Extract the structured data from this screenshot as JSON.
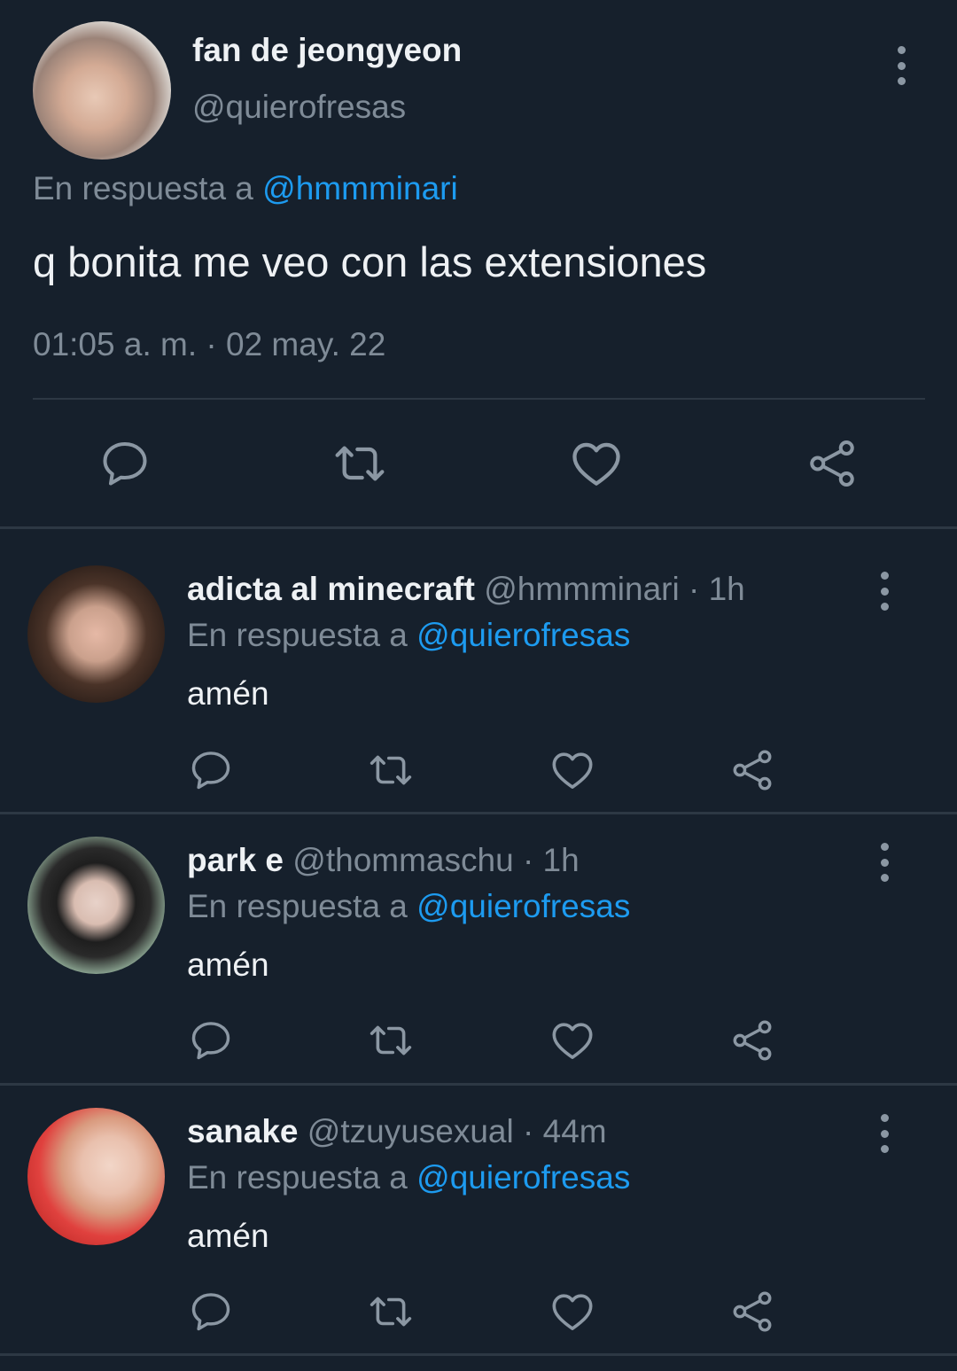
{
  "main_tweet": {
    "name": "fan de jeongyeon",
    "handle": "@quierofresas",
    "reply_prefix": "En respuesta a",
    "reply_to": "@hmmminari",
    "text": "q bonita me veo con las extensiones",
    "timestamp": "01:05 a. m. · 02 may. 22"
  },
  "replies": [
    {
      "name": "adicta al minecraft",
      "handle": "@hmmminari",
      "time": "· 1h",
      "reply_prefix": "En respuesta a",
      "reply_to": "@quierofresas",
      "text": "amén"
    },
    {
      "name": "park e",
      "handle": "@thommaschu",
      "time": "· 1h",
      "reply_prefix": "En respuesta a",
      "reply_to": "@quierofresas",
      "text": "amén"
    },
    {
      "name": "sanake",
      "handle": "@tzuyusexual",
      "time": "· 44m",
      "reply_prefix": "En respuesta a",
      "reply_to": "@quierofresas",
      "text": "amén"
    }
  ],
  "icons": {
    "reply": "speech-bubble-icon",
    "retweet": "retweet-icon",
    "like": "heart-icon",
    "share": "share-icon",
    "more": "more-vertical-icon"
  },
  "colors": {
    "background": "#16202c",
    "link": "#1d9bf0",
    "muted": "#7f8b97",
    "icon": "#8b97a3",
    "divider": "#2d3844"
  }
}
